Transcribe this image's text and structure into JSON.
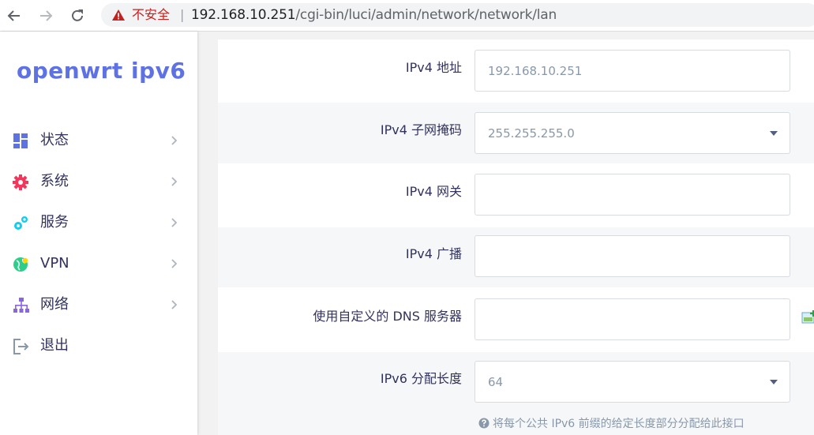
{
  "browser": {
    "security_label": "不安全",
    "separator": "|",
    "url_host": "192.168.10.251",
    "url_path": "/cgi-bin/luci/admin/network/network/lan"
  },
  "sidebar": {
    "brand": "openwrt ipv6",
    "items": [
      {
        "label": "状态",
        "icon": "dashboard-icon",
        "has_chevron": true
      },
      {
        "label": "系统",
        "icon": "gear-icon",
        "has_chevron": true
      },
      {
        "label": "服务",
        "icon": "cogs-icon",
        "has_chevron": true
      },
      {
        "label": "VPN",
        "icon": "globe-icon",
        "has_chevron": true
      },
      {
        "label": "网络",
        "icon": "sitemap-icon",
        "has_chevron": true
      },
      {
        "label": "退出",
        "icon": "logout-icon",
        "has_chevron": false
      }
    ]
  },
  "form": {
    "ipv4_address": {
      "label": "IPv4 地址",
      "value": "192.168.10.251"
    },
    "ipv4_netmask": {
      "label": "IPv4 子网掩码",
      "value": "255.255.255.0",
      "type": "select"
    },
    "ipv4_gateway": {
      "label": "IPv4 网关",
      "value": ""
    },
    "ipv4_broadcast": {
      "label": "IPv4 广播",
      "value": ""
    },
    "custom_dns": {
      "label": "使用自定义的 DNS 服务器",
      "value": ""
    },
    "ipv6_assign_length": {
      "label": "IPv6 分配长度",
      "value": "64",
      "type": "select",
      "hint": "将每个公共 IPv6 前缀的给定长度部分分配给此接口"
    }
  },
  "colors": {
    "brand": "#5e72e4",
    "insecure": "#c5221f",
    "label": "#32325d",
    "field_value": "#8898aa"
  }
}
